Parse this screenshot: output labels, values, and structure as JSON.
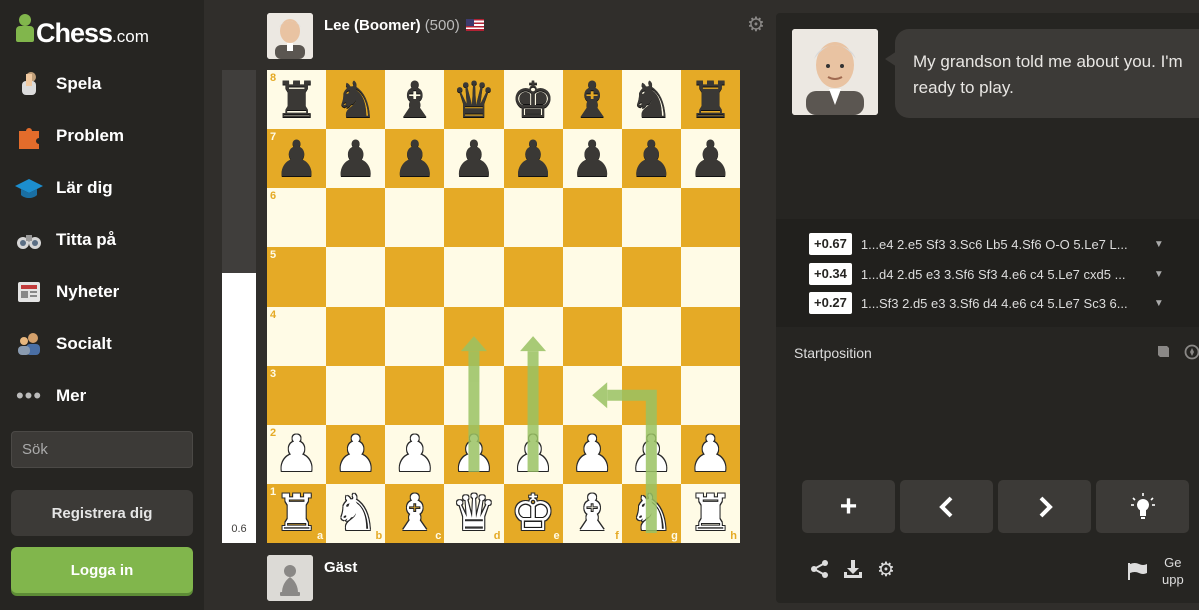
{
  "brand": {
    "name": "Chess",
    "domain": ".com",
    "accent": "#81b64c"
  },
  "nav": [
    {
      "label": "Spela",
      "icon": "hand-piece-icon"
    },
    {
      "label": "Problem",
      "icon": "puzzle-icon"
    },
    {
      "label": "Lär dig",
      "icon": "graduation-cap-icon"
    },
    {
      "label": "Titta på",
      "icon": "binoculars-icon"
    },
    {
      "label": "Nyheter",
      "icon": "newspaper-icon"
    },
    {
      "label": "Socialt",
      "icon": "people-icon"
    },
    {
      "label": "Mer",
      "icon": "more-dots-icon"
    }
  ],
  "search": {
    "placeholder": "Sök"
  },
  "auth": {
    "register_label": "Registrera dig",
    "login_label": "Logga in"
  },
  "players": {
    "top": {
      "name": "Lee (Boomer)",
      "rating": "(500)",
      "flag": "us-flag-icon"
    },
    "bottom": {
      "name": "Gäst"
    }
  },
  "eval": {
    "value": "0.6",
    "white_fraction": 0.57
  },
  "board": {
    "light": "#fffbe6",
    "dark": "#e5aa26",
    "ranks": [
      "8",
      "7",
      "6",
      "5",
      "4",
      "3",
      "2",
      "1"
    ],
    "files": [
      "a",
      "b",
      "c",
      "d",
      "e",
      "f",
      "g",
      "h"
    ],
    "position": [
      [
        "r",
        "n",
        "b",
        "q",
        "k",
        "b",
        "n",
        "r"
      ],
      [
        "p",
        "p",
        "p",
        "p",
        "p",
        "p",
        "p",
        "p"
      ],
      [
        "",
        "",
        "",
        "",
        "",
        "",
        "",
        ""
      ],
      [
        "",
        "",
        "",
        "",
        "",
        "",
        "",
        ""
      ],
      [
        "",
        "",
        "",
        "",
        "",
        "",
        "",
        ""
      ],
      [
        "",
        "",
        "",
        "",
        "",
        "",
        "",
        ""
      ],
      [
        "P",
        "P",
        "P",
        "P",
        "P",
        "P",
        "P",
        "P"
      ],
      [
        "R",
        "N",
        "B",
        "Q",
        "K",
        "B",
        "N",
        "R"
      ]
    ],
    "arrows": [
      {
        "from": "d2",
        "to": "d4"
      },
      {
        "from": "e2",
        "to": "e4"
      },
      {
        "from": "g1",
        "to": "f3",
        "knight": true
      }
    ],
    "arrow_color": "#9ac263"
  },
  "coach": {
    "message": "My grandson told me about you. I'm ready to play."
  },
  "engine_lines": [
    {
      "score": "+0.67",
      "moves": "1...e4 2.e5 Sf3 3.Sc6 Lb5 4.Sf6 O-O 5.Le7 L..."
    },
    {
      "score": "+0.34",
      "moves": "1...d4 2.d5 e3 3.Sf6 Sf3 4.e6 c4 5.Le7 cxd5 ..."
    },
    {
      "score": "+0.27",
      "moves": "1...Sf3 2.d5 e3 3.Sf6 d4 4.e6 c4 5.Le7 Sc3 6..."
    }
  ],
  "opening": {
    "label": "Startposition"
  },
  "controls": {
    "add": "+",
    "prev": "‹",
    "next": "›"
  },
  "resign": {
    "line1": "Ge",
    "line2": "upp"
  }
}
